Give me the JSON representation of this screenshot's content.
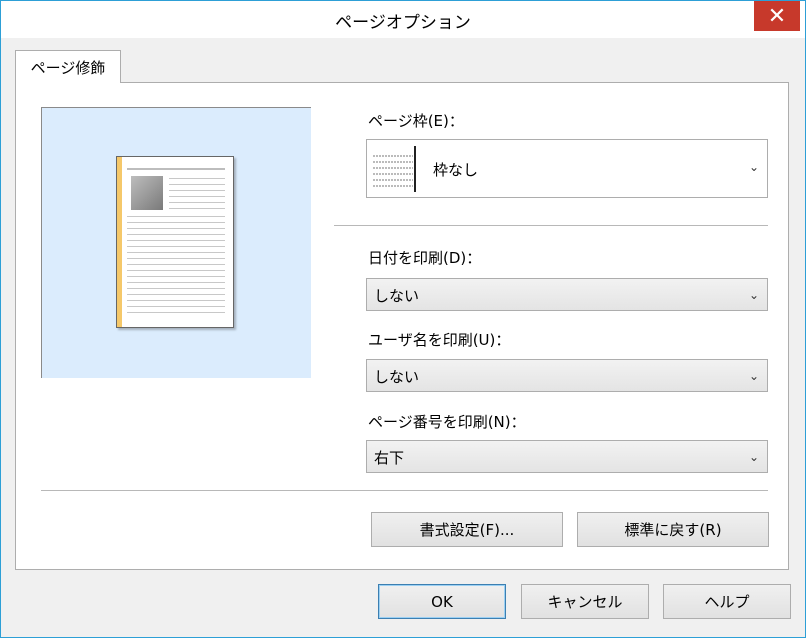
{
  "window": {
    "title": "ページオプション",
    "close_glyph": "✕",
    "tab_label": "ページ修飾"
  },
  "border": {
    "label": "ページ枠(E)：",
    "value": "枠なし"
  },
  "date": {
    "label": "日付を印刷(D)：",
    "value": "しない"
  },
  "username": {
    "label": "ユーザ名を印刷(U)：",
    "value": "しない"
  },
  "pagenum": {
    "label": "ページ番号を印刷(N)：",
    "value": "右下"
  },
  "buttons": {
    "format": "書式設定(F)...",
    "reset": "標準に戻す(R)",
    "ok": "OK",
    "cancel": "キャンセル",
    "help": "ヘルプ"
  },
  "icons": {
    "close": "close-icon",
    "dropdown": "chevron-down-icon",
    "chevron_glyph": "⌄"
  },
  "colors": {
    "accent": "#2d9fd6",
    "close_bg": "#c7392b",
    "preview_bg": "#dbecfd",
    "page_stripe": "#f5c86a"
  }
}
